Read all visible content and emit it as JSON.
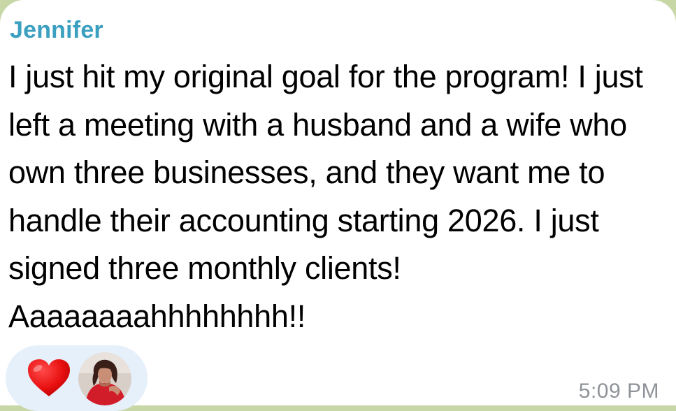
{
  "message": {
    "sender": "Jennifer",
    "sender_color": "#3b9fc0",
    "text": "I just hit my original goal for the program! I just left a meeting with a husband and a wife who own three businesses, and they want me to handle their accounting starting 2026. I just signed three monthly clients! Aaaaaaaahhhhhhhh!!",
    "time": "5:09 PM"
  },
  "reactions": {
    "emoji_icon": "red-heart-icon",
    "reactor_avatar": "avatar"
  }
}
